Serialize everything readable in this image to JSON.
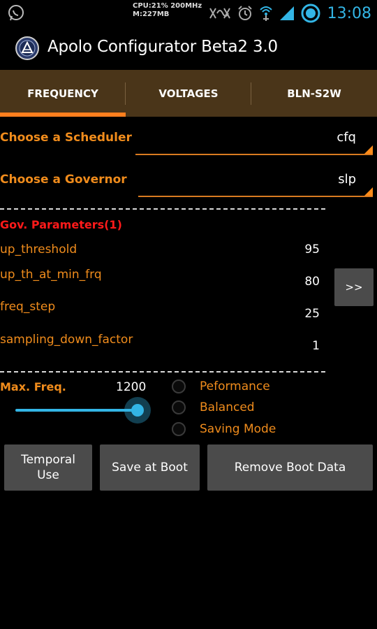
{
  "status_bar": {
    "cpu_line1": "CPU:21% 200MHz",
    "cpu_line2": "M:227MB",
    "time": "13:08",
    "icons": [
      "whatsapp-icon",
      "signal-blocked-icon",
      "alarm-icon",
      "wifi-icon",
      "cell-signal-icon",
      "battery-icon"
    ]
  },
  "action_bar": {
    "title": "Apolo Configurator Beta2 3.0"
  },
  "tabs": [
    {
      "label": "FREQUENCY",
      "active": true
    },
    {
      "label": "VOLTAGES",
      "active": false
    },
    {
      "label": "BLN-S2W",
      "active": false
    }
  ],
  "scheduler": {
    "label": "Choose a Scheduler",
    "value": "cfq"
  },
  "governor": {
    "label": "Choose a Governor",
    "value": "slp"
  },
  "gov_params": {
    "title": "Gov. Parameters(1)",
    "items": [
      {
        "name": "up_threshold",
        "value": "95"
      },
      {
        "name": "up_th_at_min_frq",
        "value": "80"
      },
      {
        "name": "freq_step",
        "value": "25"
      },
      {
        "name": "sampling_down_factor",
        "value": "1"
      }
    ],
    "next_label": ">>"
  },
  "max_freq": {
    "label": "Max. Freq.",
    "value": "1200",
    "slider_fraction": 1.0
  },
  "modes": [
    {
      "label": "Peformance",
      "checked": false
    },
    {
      "label": "Balanced",
      "checked": false
    },
    {
      "label": "Saving Mode",
      "checked": false
    }
  ],
  "buttons": {
    "temporal": "Temporal Use",
    "save_boot": "Save at Boot",
    "remove_boot": "Remove Boot Data"
  },
  "colors": {
    "accent_orange": "#ff8c1a",
    "label_orange": "#f08c1c",
    "holo_blue": "#33b5e5",
    "title_red": "#ff1a1a",
    "tab_bg": "#4a3519"
  }
}
